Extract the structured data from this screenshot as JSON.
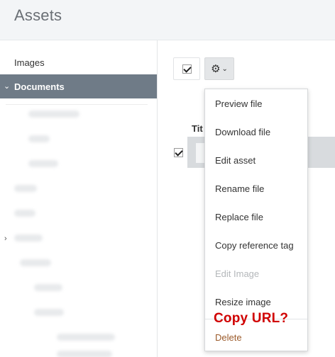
{
  "header": {
    "title": "Assets"
  },
  "sidebar": {
    "items": [
      {
        "label": "Images"
      },
      {
        "label": "Documents",
        "expanded": true,
        "selected": true
      }
    ]
  },
  "toolbar": {
    "select_all_checked": true,
    "actions_icon": "gear-icon"
  },
  "table": {
    "column_title": "Tit",
    "rows": [
      {
        "checked": true
      }
    ]
  },
  "menu": {
    "items": [
      {
        "label": "Preview file",
        "enabled": true
      },
      {
        "label": "Download file",
        "enabled": true
      },
      {
        "label": "Edit asset",
        "enabled": true
      },
      {
        "label": "Rename file",
        "enabled": true
      },
      {
        "label": "Replace file",
        "enabled": true
      },
      {
        "label": "Copy reference tag",
        "enabled": true
      },
      {
        "label": "Edit Image",
        "enabled": false
      },
      {
        "label": "Resize image",
        "enabled": true
      },
      {
        "label": "Delete",
        "enabled": true
      }
    ]
  },
  "annotation": {
    "text": "Copy URL?",
    "color": "#d00000"
  },
  "colors": {
    "selected_nav_bg": "#6f7b87",
    "header_bg": "#f3f5f7",
    "delete_text": "#9b5a2a"
  }
}
